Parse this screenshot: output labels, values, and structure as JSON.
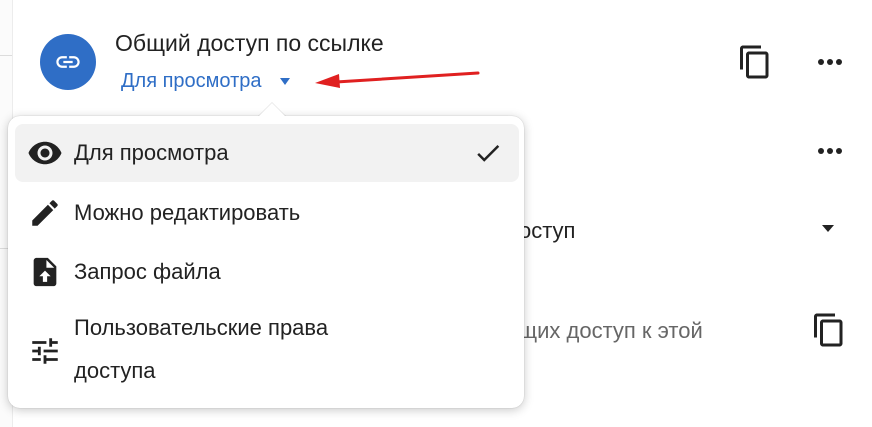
{
  "share_link": {
    "title": "Общий доступ по ссылке",
    "permission_label": "Для просмотра",
    "avatar_icon": "link-icon",
    "copy_icon": "copy-icon",
    "more_icon": "more-horizontal-icon",
    "accent_color": "#2f6ec6",
    "arrow_color": "#e02020"
  },
  "background_rows": {
    "row2_more_icon": "more-horizontal-icon",
    "row3_text_fragment": "оступ",
    "row4_text_fragment": "щих доступ к этой",
    "row4_copy_icon": "copy-icon"
  },
  "permission_menu": {
    "items": [
      {
        "label": "Для просмотра",
        "icon": "eye-icon",
        "selected": true
      },
      {
        "label": "Можно редактировать",
        "icon": "pencil-icon",
        "selected": false
      },
      {
        "label": "Запрос файла",
        "icon": "file-upload-icon",
        "selected": false
      },
      {
        "label_line1": "Пользовательские права",
        "label_line2": "доступа",
        "icon": "sliders-icon",
        "selected": false
      }
    ],
    "selected_icon": "checkmark-icon"
  }
}
